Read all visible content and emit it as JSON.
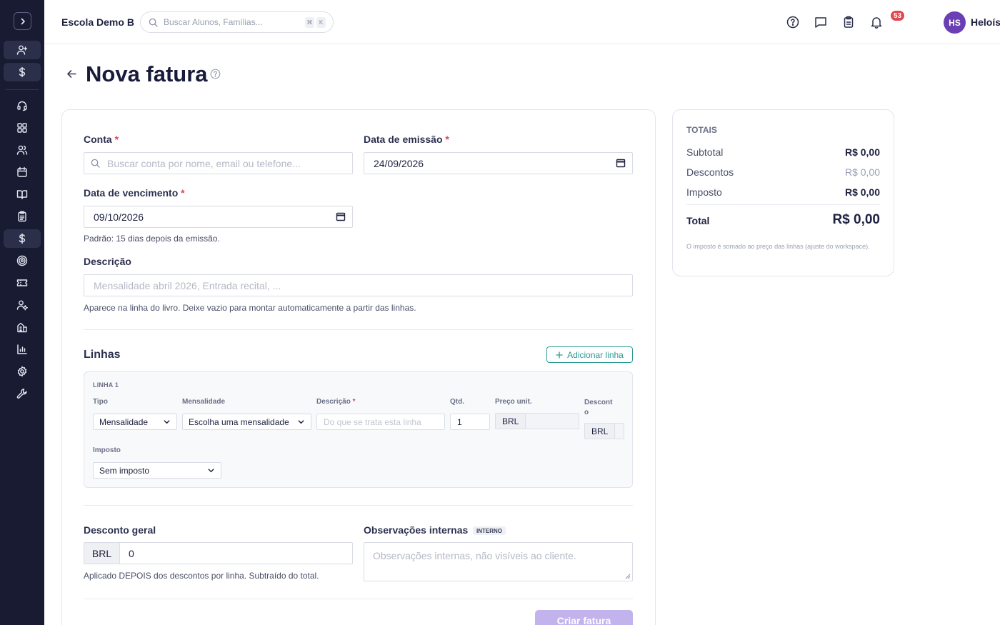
{
  "sidebar": {
    "items": [
      {
        "icon": "user-plus-icon"
      },
      {
        "icon": "dollar-icon"
      },
      {
        "icon": "headset-icon"
      },
      {
        "icon": "grid-icon"
      },
      {
        "icon": "users-icon"
      },
      {
        "icon": "calendar-icon"
      },
      {
        "icon": "book-open-icon"
      },
      {
        "icon": "clipboard-icon"
      },
      {
        "icon": "dollar-icon"
      },
      {
        "icon": "target-icon"
      },
      {
        "icon": "ticket-icon"
      },
      {
        "icon": "user-cog-icon"
      },
      {
        "icon": "building-icon"
      },
      {
        "icon": "bar-chart-icon"
      },
      {
        "icon": "gear-icon"
      },
      {
        "icon": "wrench-icon"
      }
    ],
    "active_item": "dollar"
  },
  "topbar": {
    "school_name": "Escola Demo B",
    "search_placeholder": "Buscar Alunos, Famílias...",
    "shortcut_keys": [
      "⌘",
      "K"
    ],
    "notification_count": "53",
    "user_initials": "HS",
    "user_name": "Heloísa"
  },
  "page": {
    "title": "Nova fatura"
  },
  "form": {
    "conta_label": "Conta",
    "conta_placeholder": "Buscar conta por nome, email ou telefone...",
    "emissao_label": "Data de emissão",
    "emissao_value": "24/09/2026",
    "vencimento_label": "Data de vencimento",
    "vencimento_value": "09/10/2026",
    "vencimento_hint": "Padrão: 15 dias depois da emissão.",
    "descricao_label": "Descrição",
    "descricao_placeholder": "Mensalidade abril 2026, Entrada recital, ...",
    "descricao_hint": "Aparece na linha do livro. Deixe vazio para montar automaticamente a partir das linhas.",
    "required_mark": "*"
  },
  "linhas": {
    "title": "Linhas",
    "add_button": "Adicionar linha",
    "line": {
      "title": "LINHA 1",
      "tipo_label": "Tipo",
      "tipo_value": "Mensalidade",
      "mensalidade_label": "Mensalidade",
      "mensalidade_value": "Escolha uma mensalidade",
      "descricao_label": "Descrição",
      "descricao_placeholder": "Do que se trata esta linha",
      "qtd_label": "Qtd.",
      "qtd_value": "1",
      "preco_label": "Preço unit.",
      "preco_currency": "BRL",
      "desconto_label": "Descont o",
      "desconto_currency": "BRL",
      "imposto_label": "Imposto",
      "imposto_value": "Sem imposto"
    }
  },
  "footer_form": {
    "desconto_label": "Desconto geral",
    "desconto_currency": "BRL",
    "desconto_value": "0",
    "desconto_hint": "Aplicado DEPOIS dos descontos por linha. Subtraído do total.",
    "obs_label": "Observações internas",
    "obs_badge": "INTERNO",
    "obs_placeholder": "Observações internas, não visíveis ao cliente.",
    "submit": "Criar fatura"
  },
  "totals": {
    "title": "TOTAIS",
    "subtotal_label": "Subtotal",
    "subtotal_value": "R$ 0,00",
    "descontos_label": "Descontos",
    "descontos_value": "R$ 0,00",
    "imposto_label": "Imposto",
    "imposto_value": "R$ 0,00",
    "total_label": "Total",
    "total_value": "R$ 0,00",
    "note": "O imposto é somado ao preço das linhas (ajuste do workspace)."
  },
  "colors": {
    "sidebar_bg": "#181b31",
    "accent_teal": "#2d9b93",
    "avatar_purple": "#6a3fb5",
    "badge_red": "#e0474f",
    "submit_disabled": "#c2b3ec"
  }
}
